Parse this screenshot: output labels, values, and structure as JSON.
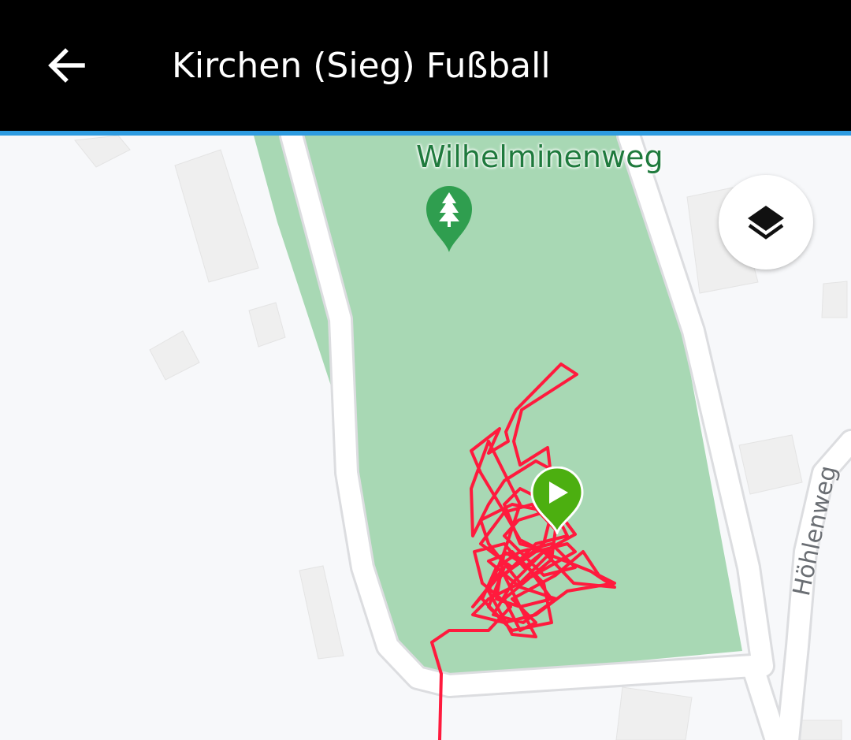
{
  "header": {
    "title": "Kirchen (Sieg) Fußball",
    "back_icon": "arrow-left-icon",
    "background": "#000000",
    "accent_color": "#2d9be0"
  },
  "map": {
    "park_label": "Wilhelminenweg",
    "street_label": "Höhlenweg",
    "park_color": "#a8d8b4",
    "road_color": "#ffffff",
    "building_color": "#efefef",
    "track_color": "#ff1a3d",
    "start_marker_icon": "play-icon",
    "start_marker_color": "#4caf10",
    "poi_marker_icon": "tree-icon",
    "poi_marker_color": "#2f9e4f",
    "layers_button_icon": "layers-icon"
  }
}
